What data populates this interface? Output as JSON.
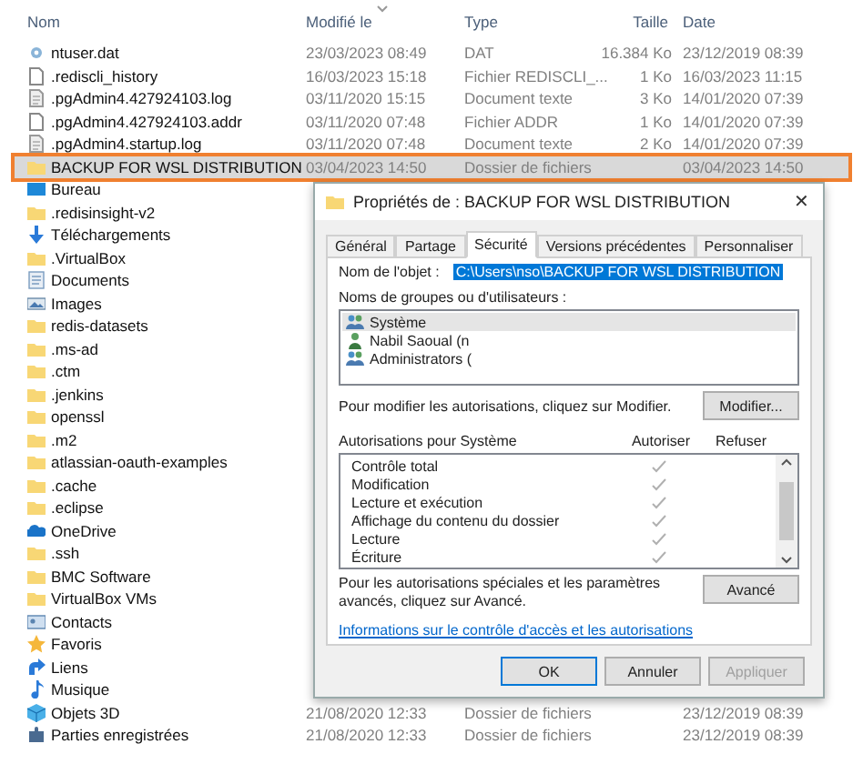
{
  "columns": [
    "Nom",
    "Modifié le",
    "Type",
    "Taille",
    "Date"
  ],
  "rows": [
    {
      "kind": "system",
      "name": "ntuser.dat",
      "modified": "23/03/2023 08:49",
      "type": "DAT",
      "size": "16.384 Ko",
      "date": "23/12/2019 08:39",
      "selected": false
    },
    {
      "kind": "file",
      "name": ".rediscli_history",
      "modified": "16/03/2023 15:18",
      "type": "Fichier REDISCLI_...",
      "size": "1 Ko",
      "date": "16/03/2023 11:15",
      "selected": false
    },
    {
      "kind": "text",
      "name": ".pgAdmin4.427924103.log",
      "modified": "03/11/2020 15:15",
      "type": "Document texte",
      "size": "3 Ko",
      "date": "14/01/2020 07:39",
      "selected": false
    },
    {
      "kind": "file",
      "name": ".pgAdmin4.427924103.addr",
      "modified": "03/11/2020 07:48",
      "type": "Fichier ADDR",
      "size": "1 Ko",
      "date": "14/01/2020 07:39",
      "selected": false
    },
    {
      "kind": "text",
      "name": ".pgAdmin4.startup.log",
      "modified": "03/11/2020 07:48",
      "type": "Document texte",
      "size": "2 Ko",
      "date": "14/01/2020 07:39",
      "selected": false
    },
    {
      "kind": "folder",
      "name": "BACKUP FOR WSL DISTRIBUTION",
      "modified": "03/04/2023 14:50",
      "type": "Dossier de fichiers",
      "date": "03/04/2023 14:50",
      "selected": true
    },
    {
      "kind": "desktop",
      "name": "Bureau",
      "selected": false
    },
    {
      "kind": "folder",
      "name": ".redisinsight-v2",
      "selected": false
    },
    {
      "kind": "download",
      "name": "Téléchargements",
      "selected": false
    },
    {
      "kind": "folder",
      "name": ".VirtualBox",
      "selected": false
    },
    {
      "kind": "documents",
      "name": "Documents",
      "selected": false
    },
    {
      "kind": "images",
      "name": "Images",
      "selected": false
    },
    {
      "kind": "folder",
      "name": "redis-datasets",
      "selected": false
    },
    {
      "kind": "folder",
      "name": ".ms-ad",
      "selected": false
    },
    {
      "kind": "folder",
      "name": ".ctm",
      "selected": false
    },
    {
      "kind": "folder",
      "name": ".jenkins",
      "selected": false
    },
    {
      "kind": "folder",
      "name": "openssl",
      "selected": false
    },
    {
      "kind": "folder",
      "name": ".m2",
      "selected": false
    },
    {
      "kind": "folder",
      "name": "atlassian-oauth-examples",
      "selected": false
    },
    {
      "kind": "folder",
      "name": ".cache",
      "selected": false
    },
    {
      "kind": "folder",
      "name": ".eclipse",
      "selected": false
    },
    {
      "kind": "cloud",
      "name": "OneDrive",
      "selected": false
    },
    {
      "kind": "folder",
      "name": ".ssh",
      "selected": false
    },
    {
      "kind": "folder",
      "name": "BMC Software",
      "selected": false
    },
    {
      "kind": "folder",
      "name": "VirtualBox VMs",
      "selected": false
    },
    {
      "kind": "contacts",
      "name": "Contacts",
      "selected": false
    },
    {
      "kind": "star",
      "name": "Favoris",
      "selected": false
    },
    {
      "kind": "links",
      "name": "Liens",
      "selected": false
    },
    {
      "kind": "music",
      "name": "Musique",
      "selected": false
    },
    {
      "kind": "cube",
      "name": "Objets 3D",
      "modified": "21/08/2020 12:33",
      "type": "Dossier de fichiers",
      "date": "23/12/2019 08:39",
      "selected": false
    },
    {
      "kind": "games",
      "name": "Parties enregistrées",
      "modified": "21/08/2020 12:33",
      "type": "Dossier de fichiers",
      "date": "23/12/2019 08:39",
      "selected": false
    }
  ],
  "dialog": {
    "title": "Propriétés de : BACKUP FOR WSL DISTRIBUTION",
    "close": "✕",
    "tabs": [
      {
        "label": "Général",
        "selected": false
      },
      {
        "label": "Partage",
        "selected": false
      },
      {
        "label": "Sécurité",
        "selected": true
      },
      {
        "label": "Versions précédentes",
        "selected": false
      },
      {
        "label": "Personnaliser",
        "selected": false
      }
    ],
    "object_label": "Nom de l'objet :",
    "object_value": "C:\\Users\\nso\\BACKUP FOR WSL DISTRIBUTION",
    "groups_label": "Noms de groupes ou d'utilisateurs :",
    "groups": [
      {
        "kind": "group",
        "name": "Système",
        "selected": true
      },
      {
        "kind": "user",
        "name": "Nabil Saoual (n",
        "selected": false
      },
      {
        "kind": "group",
        "name": "Administrators (",
        "selected": false
      }
    ],
    "modify_hint": "Pour modifier les autorisations, cliquez sur Modifier.",
    "modify_button": "Modifier...",
    "permissions_label": "Autorisations pour Système",
    "allow_label": "Autoriser",
    "deny_label": "Refuser",
    "permissions": [
      {
        "name": "Contrôle total",
        "allow": true,
        "deny": false
      },
      {
        "name": "Modification",
        "allow": true,
        "deny": false
      },
      {
        "name": "Lecture et exécution",
        "allow": true,
        "deny": false
      },
      {
        "name": "Affichage du contenu du dossier",
        "allow": true,
        "deny": false
      },
      {
        "name": "Lecture",
        "allow": true,
        "deny": false
      },
      {
        "name": "Écriture",
        "allow": true,
        "deny": false
      }
    ],
    "advanced_hint": "Pour les autorisations spéciales et les paramètres avancés, cliquez sur Avancé.",
    "advanced_button": "Avancé",
    "link": "Informations sur le contrôle d'accès et les autorisations",
    "buttons": [
      {
        "label": "OK",
        "kind": "default"
      },
      {
        "label": "Annuler",
        "kind": "normal"
      },
      {
        "label": "Appliquer",
        "kind": "disabled"
      }
    ]
  }
}
